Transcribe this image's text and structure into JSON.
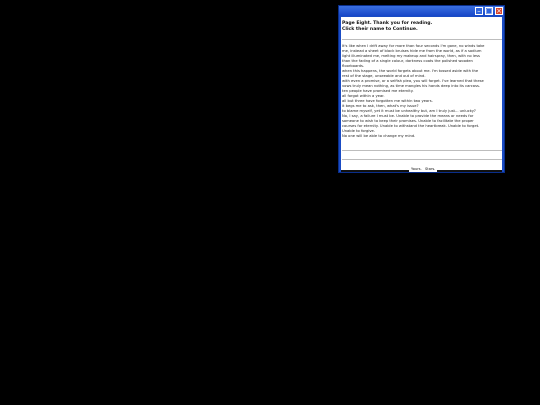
{
  "window": {
    "controls": [
      "minimize-icon",
      "maximize-icon",
      "close-icon"
    ]
  },
  "header": {
    "line1": "Page Eight. Thank you for reading.",
    "line2": "Click their name to Continue."
  },
  "body_lines": [
    "It's like when I drift away for more than four seconds I'm gone, no winds take",
    "me, instead a sheet of black bruises hide me from the world, as if a sodium",
    "light illuminated me, melting my makeup and hairspray, then, with no less",
    "than the fading of a single colour, darkness coats the polished wooden",
    "floorboards.",
    "when this happens, the world forgets about me. I'm tossed aside with the",
    "rest of the stage, unseeable and out of mind.",
    "with even a promise, or a selfish plea, you will forget. I've learned that these",
    "vows truly mean nothing, as time mangles his hands deep into its carcass.",
    "ten people have promised me eternity.",
    "all forgot within a year.",
    "all but three have forgotten me within two years.",
    "it begs me to ask, then, what's my issue?",
    "to blame myself, yet it must be unhealthy but, am I truly just... unlucky?",
    "No, I say, a failure I must be. Unable to provide the means or needs for",
    "someone to wish to keep their promises. Unable to facilitate the proper",
    "courses for eternity. Unable to withstand the heartbreak. Unable to forget.",
    "Unable to forgive.",
    "No one will be able to change my mind."
  ],
  "nav": {
    "link1": "Yours.",
    "link2": "Stars."
  }
}
